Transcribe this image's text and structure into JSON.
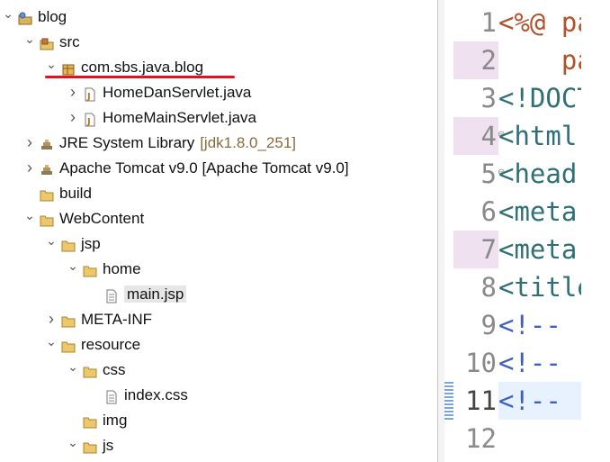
{
  "explorer": {
    "items": [
      {
        "label": "blog",
        "twisty": "expanded",
        "icon": "project-icon"
      },
      {
        "label": "src",
        "twisty": "expanded",
        "icon": "source-folder-icon"
      },
      {
        "label": "com.sbs.java.blog",
        "twisty": "expanded",
        "icon": "package-icon"
      },
      {
        "label": "HomeDanServlet.java",
        "twisty": "collapsed",
        "icon": "java-file-icon"
      },
      {
        "label": "HomeMainServlet.java",
        "twisty": "collapsed",
        "icon": "java-file-icon"
      },
      {
        "label": "JRE System Library",
        "decoration": "[jdk1.8.0_251]",
        "twisty": "collapsed",
        "icon": "library-icon"
      },
      {
        "label": "Apache Tomcat v9.0 [Apache Tomcat v9.0]",
        "twisty": "collapsed",
        "icon": "library-icon"
      },
      {
        "label": "build",
        "twisty": "none",
        "icon": "folder-icon"
      },
      {
        "label": "WebContent",
        "twisty": "expanded",
        "icon": "folder-icon"
      },
      {
        "label": "jsp",
        "twisty": "expanded",
        "icon": "folder-icon"
      },
      {
        "label": "home",
        "twisty": "expanded",
        "icon": "folder-icon"
      },
      {
        "label": "main.jsp",
        "twisty": "none",
        "icon": "file-icon",
        "selected": true
      },
      {
        "label": "META-INF",
        "twisty": "collapsed",
        "icon": "folder-icon"
      },
      {
        "label": "resource",
        "twisty": "expanded",
        "icon": "folder-icon"
      },
      {
        "label": "css",
        "twisty": "expanded",
        "icon": "folder-icon"
      },
      {
        "label": "index.css",
        "twisty": "none",
        "icon": "file-icon"
      },
      {
        "label": "img",
        "twisty": "none",
        "icon": "folder-icon"
      },
      {
        "label": "js",
        "twisty": "expanded",
        "icon": "folder-icon"
      }
    ],
    "annotation_color": "#e0141e"
  },
  "editor": {
    "lines": [
      {
        "num": "1",
        "text": "<%@ pa",
        "kind": "jsp"
      },
      {
        "num": "2",
        "text": "    pa",
        "kind": "jsp"
      },
      {
        "num": "3",
        "text": "<!DOCT",
        "kind": "tag"
      },
      {
        "num": "4",
        "text": "<html",
        "kind": "tag"
      },
      {
        "num": "5",
        "text": "<head",
        "kind": "tag"
      },
      {
        "num": "6",
        "text": "<meta",
        "kind": "tag"
      },
      {
        "num": "7",
        "text": "<meta",
        "kind": "tag"
      },
      {
        "num": "8",
        "text": "<title",
        "kind": "tag"
      },
      {
        "num": "9",
        "text": "<!--",
        "kind": "cmt"
      },
      {
        "num": "10",
        "text": "<!--",
        "kind": "cmt"
      },
      {
        "num": "11",
        "text": "<!--",
        "kind": "cmt"
      },
      {
        "num": "12",
        "text": "",
        "kind": "cmt"
      }
    ],
    "current_line": "11",
    "highlighted_lines": [
      "2",
      "4",
      "7"
    ],
    "fold_lines": [
      "4",
      "5"
    ]
  }
}
